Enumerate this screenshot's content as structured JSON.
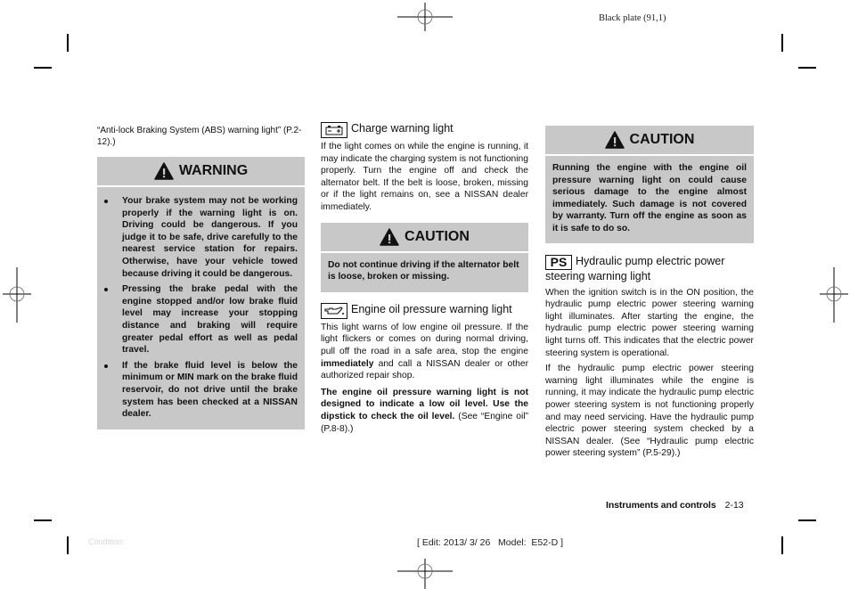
{
  "print_marks": {
    "plate_label": "Black plate (91,1)",
    "condition_label": "Condition:",
    "edit_info": "[ Edit: 2013/ 3/ 26   Model:  E52-D ]"
  },
  "footer": {
    "section_title": "Instruments and controls",
    "page_number": "2-13"
  },
  "column1": {
    "intro_ref": "“Anti-lock Braking System (ABS) warning light” (P.2-12).)",
    "warning": {
      "icon": "warning-triangle-icon",
      "title": "WARNING",
      "items": [
        "Your brake system may not be working properly if the warning light is on. Driving could be dangerous. If you judge it to be safe, drive carefully to the nearest service station for repairs. Otherwise, have your vehicle towed because driving it could be dangerous.",
        "Pressing the brake pedal with the engine stopped and/or low brake fluid level may increase your stopping distance and braking will require greater pedal effort as well as pedal travel.",
        "If the brake fluid level is below the minimum or MIN mark on the brake fluid reservoir, do not drive until the brake system has been checked at a NISSAN dealer."
      ]
    }
  },
  "column2": {
    "charge": {
      "icon": "battery-icon",
      "title": "Charge warning light",
      "text": "If the light comes on while the engine is running, it may indicate the charging system is not functioning properly. Turn the engine off and check the alternator belt. If the belt is loose, broken, missing or if the light remains on, see a NISSAN dealer immediately."
    },
    "caution": {
      "icon": "warning-triangle-icon",
      "title": "CAUTION",
      "text": "Do not continue driving if the alternator belt is loose, broken or missing."
    },
    "oil": {
      "icon": "oil-can-icon",
      "title": "Engine oil pressure warning light",
      "text_before": "This light warns of low engine oil pressure. If the light flickers or comes on during normal driving, pull off the road in a safe area, stop the engine ",
      "text_bold": "immediately",
      "text_after": " and call a NISSAN dealer or other authorized repair shop.",
      "note_bold": "The engine oil pressure warning light is not designed to indicate a low oil level. Use the dipstick to check the oil level.",
      "note_after": " (See “Engine oil” (P.8-8).)"
    }
  },
  "column3": {
    "caution": {
      "icon": "warning-triangle-icon",
      "title": "CAUTION",
      "text": "Running the engine with the engine oil pressure warning light on could cause serious damage to the engine almost immediately. Such damage is not covered by warranty. Turn off the engine as soon as it is safe to do so."
    },
    "ps": {
      "icon_label": "PS",
      "title": "Hydraulic pump electric power steering warning light",
      "para1": "When the ignition switch is in the ON position, the hydraulic pump electric power steering warning light illuminates. After starting the engine, the hydraulic pump electric power steering warning light turns off. This indicates that the electric power steering system is operational.",
      "para2": "If the hydraulic pump electric power steering warning light illuminates while the engine is running, it may indicate the hydraulic pump electric power steering system is not functioning properly and may need servicing. Have the hydraulic pump electric power steering system checked by a NISSAN dealer. (See “Hydraulic pump electric power steering system” (P.5-29).)"
    }
  }
}
